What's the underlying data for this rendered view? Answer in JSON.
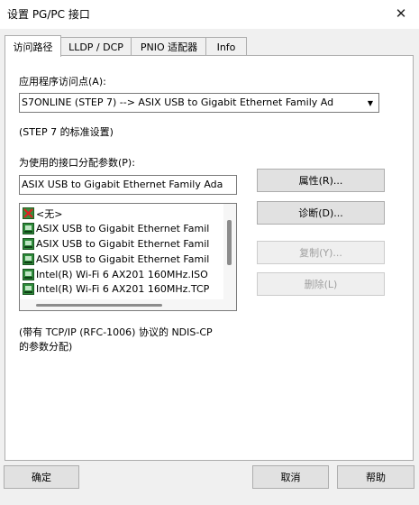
{
  "window": {
    "title": "设置 PG/PC 接口",
    "close_glyph": "✕"
  },
  "tabs": [
    {
      "label": "访问路径",
      "active": true
    },
    {
      "label": "LLDP / DCP",
      "active": false
    },
    {
      "label": "PNIO 适配器",
      "active": false
    },
    {
      "label": "Info",
      "active": false
    }
  ],
  "access_point": {
    "label": "应用程序访问点(A):",
    "value": "S7ONLINE (STEP 7)       --> ASIX USB to Gigabit Ethernet Family Ad",
    "description": "(STEP 7 的标准设置)"
  },
  "interface": {
    "label": "为使用的接口分配参数(P):",
    "value": "ASIX USB to Gigabit Ethernet Family Ada",
    "items": [
      {
        "label": "<无>",
        "icon": "none-icon"
      },
      {
        "label": "ASIX USB to Gigabit Ethernet Famil",
        "icon": "network-adapter-icon"
      },
      {
        "label": "ASIX USB to Gigabit Ethernet Famil",
        "icon": "network-adapter-icon"
      },
      {
        "label": "ASIX USB to Gigabit Ethernet Famil",
        "icon": "network-adapter-icon"
      },
      {
        "label": "Intel(R) Wi-Fi 6 AX201 160MHz.ISO",
        "icon": "network-adapter-icon"
      },
      {
        "label": "Intel(R) Wi-Fi 6 AX201 160MHz.TCP",
        "icon": "network-adapter-icon"
      }
    ],
    "description_line1": "(带有 TCP/IP (RFC-1006) 协议的 NDIS-CP",
    "description_line2": "的参数分配)"
  },
  "side_buttons": {
    "properties": "属性(R)...",
    "diagnostics": "诊断(D)...",
    "copy": "复制(Y)...",
    "delete": "删除(L)"
  },
  "footer_buttons": {
    "ok": "确定",
    "cancel": "取消",
    "help": "帮助"
  },
  "colors": {
    "window_bg": "#f0f0f0",
    "panel_bg": "#ffffff",
    "disabled_text": "#a0a0a0"
  }
}
